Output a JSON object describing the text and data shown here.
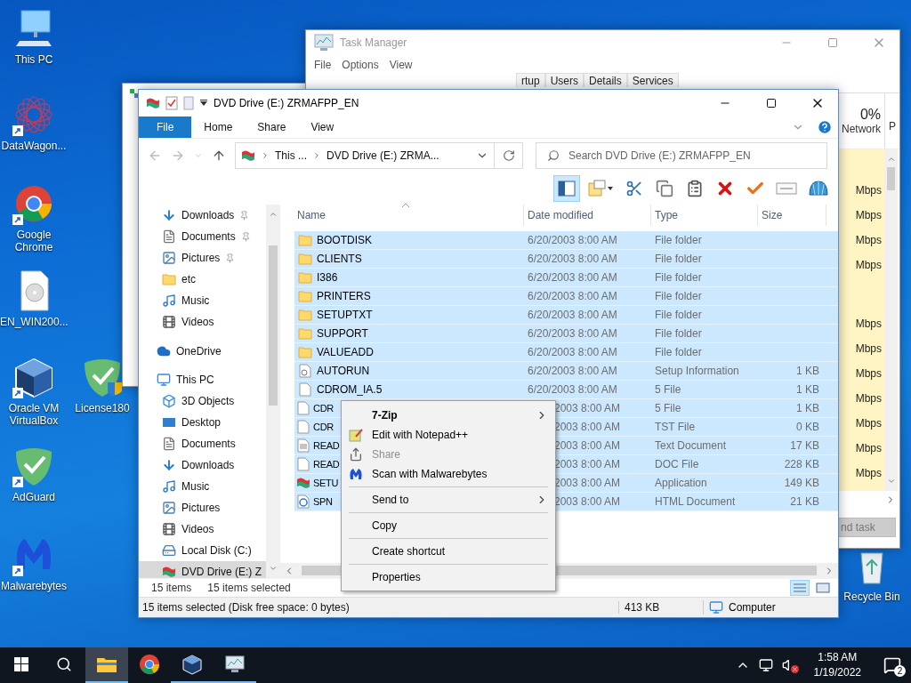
{
  "desktop": {
    "icons": [
      {
        "label": "This PC",
        "kind": "pc",
        "shortcut": false
      },
      {
        "label": "DataWagon...",
        "kind": "lattice",
        "shortcut": true
      },
      {
        "label": "Google Chrome",
        "kind": "chrome",
        "shortcut": true
      },
      {
        "label": "EN_WIN200...",
        "kind": "disc-file",
        "shortcut": false
      },
      {
        "label": "Oracle VM VirtualBox",
        "kind": "cube",
        "shortcut": true
      },
      {
        "label": "License180",
        "kind": "shield-uac",
        "shortcut": false
      },
      {
        "label": "AdGuard",
        "kind": "shield",
        "shortcut": true
      },
      {
        "label": "Malwarebytes",
        "kind": "m-logo",
        "shortcut": true
      },
      {
        "label": "Recycle Bin",
        "kind": "bin",
        "shortcut": false
      }
    ]
  },
  "task_manager": {
    "title": "Task Manager",
    "menu": [
      "File",
      "Options",
      "View"
    ],
    "tabs": [
      {
        "label": "rtup",
        "selected": false
      },
      {
        "label": "Users",
        "selected": false
      },
      {
        "label": "Details",
        "selected": false
      },
      {
        "label": "Services",
        "selected": false
      }
    ],
    "network": {
      "percent": "0%",
      "label": "Network",
      "next_column": "P",
      "rows": [
        {
          "kind": "reading",
          "text": "Mbps"
        },
        {
          "kind": "reading",
          "text": "Mbps"
        },
        {
          "kind": "reading",
          "text": "Mbps"
        },
        {
          "kind": "reading",
          "text": "Mbps"
        },
        {
          "kind": "gap"
        },
        {
          "kind": "reading",
          "text": "Mbps"
        },
        {
          "kind": "reading",
          "text": "Mbps"
        },
        {
          "kind": "reading",
          "text": "Mbps"
        },
        {
          "kind": "reading",
          "text": "Mbps"
        },
        {
          "kind": "reading",
          "text": "Mbps"
        },
        {
          "kind": "reading",
          "text": "Mbps"
        },
        {
          "kind": "reading",
          "text": "Mbps"
        }
      ]
    },
    "end_task_button": "nd task"
  },
  "explorer": {
    "title": "DVD Drive (E:) ZRMAFPP_EN",
    "ribbon_tabs": [
      {
        "label": "File",
        "selected": true
      },
      {
        "label": "Home",
        "selected": false
      },
      {
        "label": "Share",
        "selected": false
      },
      {
        "label": "View",
        "selected": false
      }
    ],
    "address": {
      "crumbs": [
        "This ...",
        "DVD Drive (E:) ZRMA..."
      ]
    },
    "search": {
      "placeholder": "Search DVD Drive (E:) ZRMAFPP_EN"
    },
    "toolbar": [
      {
        "kind": "pane",
        "selected": true
      },
      {
        "kind": "properties",
        "selected": false
      },
      {
        "kind": "cut",
        "selected": false
      },
      {
        "kind": "copy",
        "selected": false
      },
      {
        "kind": "paste",
        "selected": false
      },
      {
        "kind": "delete",
        "selected": false
      },
      {
        "kind": "check",
        "selected": false
      },
      {
        "kind": "rename",
        "selected": false
      },
      {
        "kind": "shell",
        "selected": false
      }
    ],
    "nav_pane": {
      "quick_access": [
        {
          "label": "Downloads",
          "kind": "download",
          "pinned": true,
          "selected": false
        },
        {
          "label": "Documents",
          "kind": "document",
          "pinned": true,
          "selected": false
        },
        {
          "label": "Pictures",
          "kind": "pictures",
          "pinned": true,
          "selected": false
        },
        {
          "label": "etc",
          "kind": "folder",
          "pinned": false,
          "selected": false
        },
        {
          "label": "Music",
          "kind": "music",
          "pinned": false,
          "selected": false
        },
        {
          "label": "Videos",
          "kind": "videos",
          "pinned": false,
          "selected": false
        }
      ],
      "locations": [
        {
          "label": "OneDrive",
          "kind": "cloud",
          "selected": false
        },
        {
          "label": "This PC",
          "kind": "pc",
          "selected": false,
          "children": [
            {
              "label": "3D Objects",
              "kind": "cube",
              "selected": false
            },
            {
              "label": "Desktop",
              "kind": "desktop",
              "selected": false
            },
            {
              "label": "Documents",
              "kind": "document",
              "selected": false
            },
            {
              "label": "Downloads",
              "kind": "download",
              "selected": false
            },
            {
              "label": "Music",
              "kind": "music",
              "selected": false
            },
            {
              "label": "Pictures",
              "kind": "pictures",
              "selected": false
            },
            {
              "label": "Videos",
              "kind": "videos",
              "selected": false
            },
            {
              "label": "Local Disk (C:)",
              "kind": "disk",
              "selected": false
            },
            {
              "label": "DVD Drive (E:) Z",
              "kind": "dvd",
              "selected": true
            }
          ]
        }
      ]
    },
    "columns": [
      "Name",
      "Date modified",
      "Type",
      "Size"
    ],
    "rows": [
      {
        "name": "BOOTDISK",
        "date": "6/20/2003 8:00 AM",
        "type": "File folder",
        "kind": "folder",
        "selected": true,
        "under_menu": false
      },
      {
        "name": "CLIENTS",
        "date": "6/20/2003 8:00 AM",
        "type": "File folder",
        "kind": "folder",
        "selected": true,
        "under_menu": false
      },
      {
        "name": "I386",
        "date": "6/20/2003 8:00 AM",
        "type": "File folder",
        "kind": "folder",
        "selected": true,
        "under_menu": false
      },
      {
        "name": "PRINTERS",
        "date": "6/20/2003 8:00 AM",
        "type": "File folder",
        "kind": "folder",
        "selected": true,
        "under_menu": false
      },
      {
        "name": "SETUPTXT",
        "date": "6/20/2003 8:00 AM",
        "type": "File folder",
        "kind": "folder",
        "selected": true,
        "under_menu": false
      },
      {
        "name": "SUPPORT",
        "date": "6/20/2003 8:00 AM",
        "type": "File folder",
        "kind": "folder",
        "selected": true,
        "under_menu": false
      },
      {
        "name": "VALUEADD",
        "date": "6/20/2003 8:00 AM",
        "type": "File folder",
        "kind": "folder",
        "selected": true,
        "under_menu": false
      },
      {
        "name": "AUTORUN",
        "date": "6/20/2003 8:00 AM",
        "type": "Setup Information",
        "size": "1 KB",
        "kind": "setup-info",
        "selected": true,
        "under_menu": false
      },
      {
        "name": "CDROM_IA.5",
        "date": "6/20/2003 8:00 AM",
        "type": "5 File",
        "size": "1 KB",
        "kind": "file",
        "selected": true,
        "under_menu": false
      },
      {
        "name": "CDR",
        "date": "2003 8:00 AM",
        "type": "5 File",
        "size": "1 KB",
        "kind": "file",
        "selected": true,
        "under_menu": true
      },
      {
        "name": "CDR",
        "date": "2003 8:00 AM",
        "type": "TST File",
        "size": "0 KB",
        "kind": "file",
        "selected": true,
        "under_menu": true
      },
      {
        "name": "READ",
        "date": "2003 8:00 AM",
        "type": "Text Document",
        "size": "17 KB",
        "kind": "text",
        "selected": true,
        "under_menu": true
      },
      {
        "name": "READ",
        "date": "2003 8:00 AM",
        "type": "DOC File",
        "size": "228 KB",
        "kind": "file",
        "selected": true,
        "under_menu": true
      },
      {
        "name": "SETU",
        "date": "2003 8:00 AM",
        "type": "Application",
        "size": "149 KB",
        "kind": "app",
        "selected": true,
        "under_menu": true
      },
      {
        "name": "SPN",
        "date": "2003 8:00 AM",
        "type": "HTML Document",
        "size": "21 KB",
        "kind": "html",
        "selected": true,
        "under_menu": true
      }
    ],
    "item_count": "15 items",
    "selection_count": "15 items selected",
    "view_buttons": [
      {
        "kind": "details",
        "selected": true
      },
      {
        "kind": "tiles",
        "selected": false
      }
    ],
    "status_bar": {
      "text": "15 items selected (Disk free space: 0 bytes)",
      "size": "413 KB",
      "zone": "Computer"
    }
  },
  "context_menu": {
    "items": [
      {
        "kind": "plain",
        "label": "7-Zip",
        "bold": true,
        "submenu": true,
        "disabled": false
      },
      {
        "kind": "notepad",
        "label": "Edit with Notepad++",
        "bold": false,
        "submenu": false,
        "disabled": false
      },
      {
        "kind": "share",
        "label": "Share",
        "bold": false,
        "submenu": false,
        "disabled": true
      },
      {
        "kind": "malware",
        "label": "Scan with Malwarebytes",
        "bold": false,
        "submenu": false,
        "disabled": false
      },
      {
        "kind": "separator"
      },
      {
        "kind": "plain",
        "label": "Send to",
        "bold": false,
        "submenu": true,
        "disabled": false
      },
      {
        "kind": "separator"
      },
      {
        "kind": "plain",
        "label": "Copy",
        "bold": false,
        "submenu": false,
        "disabled": false
      },
      {
        "kind": "separator"
      },
      {
        "kind": "plain",
        "label": "Create shortcut",
        "bold": false,
        "submenu": false,
        "disabled": false
      },
      {
        "kind": "separator"
      },
      {
        "kind": "plain",
        "label": "Properties",
        "bold": false,
        "submenu": false,
        "disabled": false
      }
    ]
  },
  "taskbar": {
    "apps": [
      {
        "kind": "explorer",
        "running": true,
        "active": true
      },
      {
        "kind": "chrome",
        "running": false,
        "active": false
      },
      {
        "kind": "cube",
        "running": true,
        "active": false
      },
      {
        "kind": "taskmgr",
        "running": true,
        "active": false
      }
    ],
    "volume_muted": true,
    "clock": {
      "time": "1:58 AM",
      "date": "1/19/2022"
    },
    "notifications": "2"
  }
}
